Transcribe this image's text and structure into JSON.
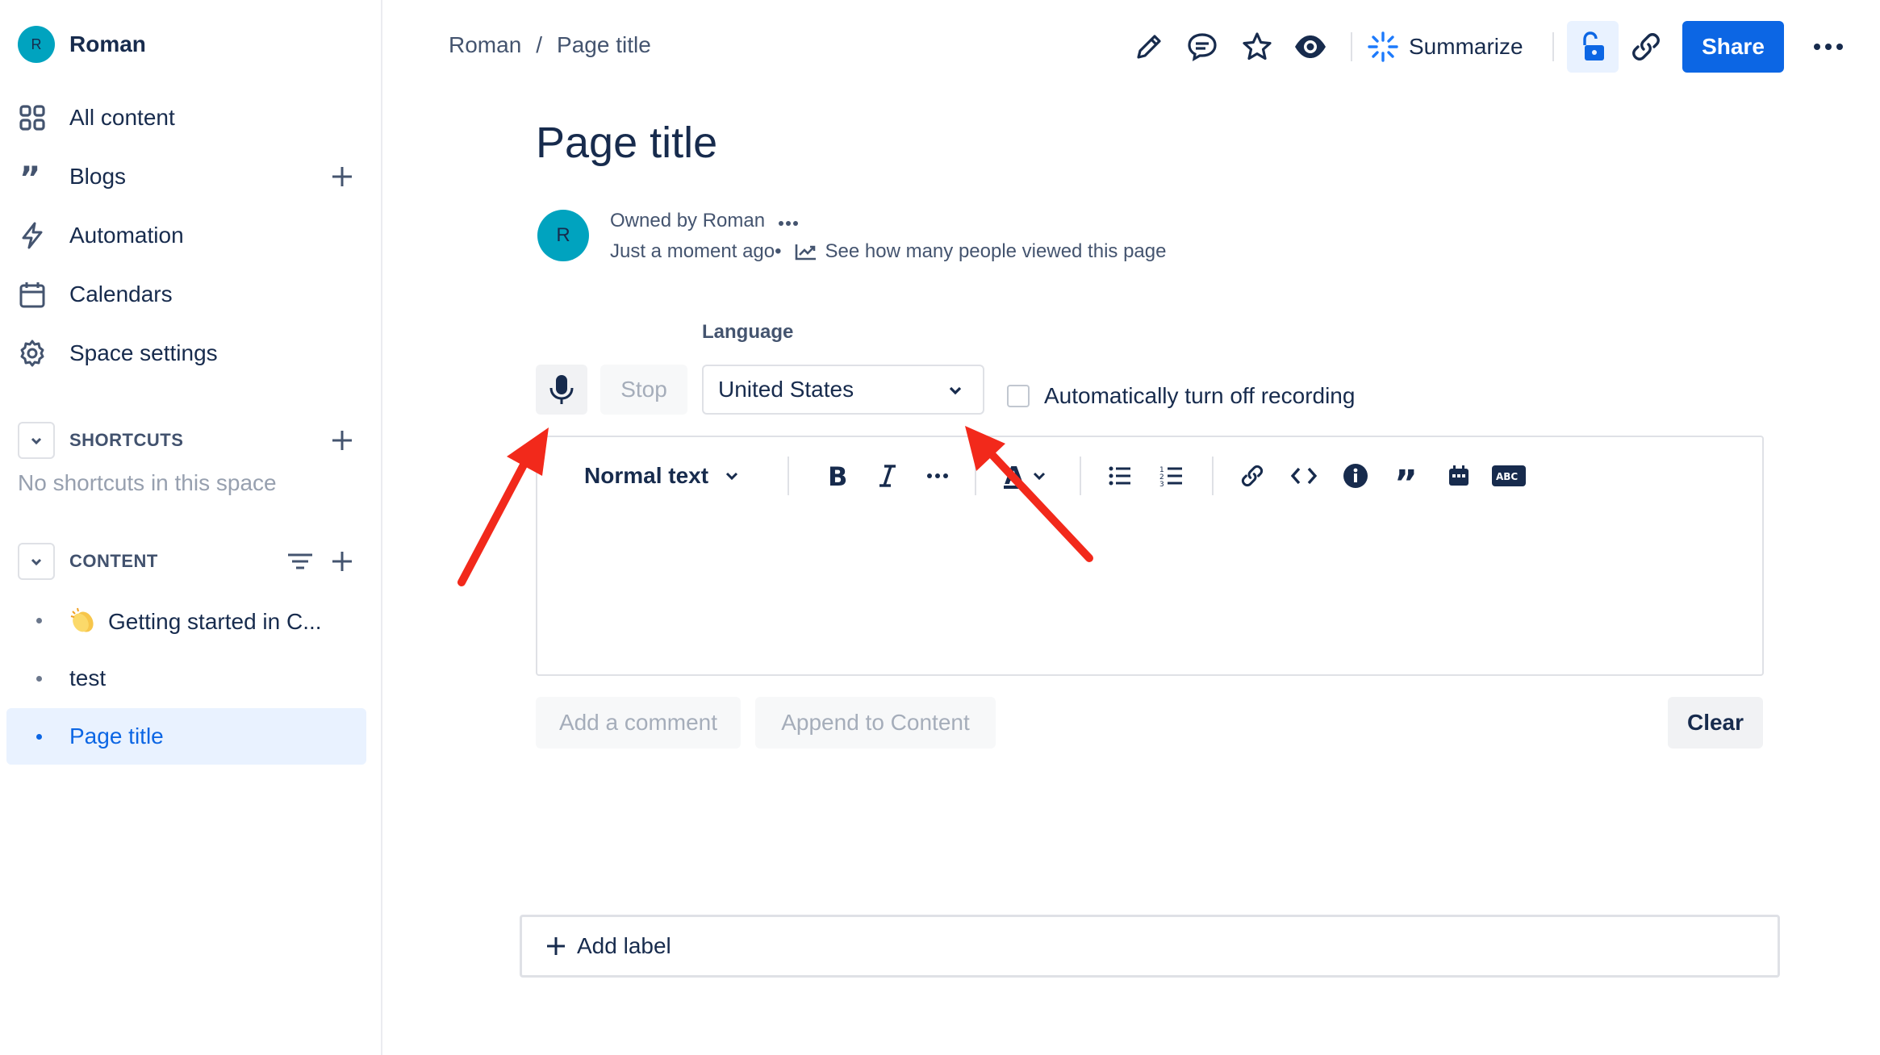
{
  "space": {
    "avatar_letter": "R",
    "name": "Roman"
  },
  "sidebar": {
    "items": [
      {
        "label": "All content",
        "icon": "grid-icon"
      },
      {
        "label": "Blogs",
        "icon": "quote-icon"
      },
      {
        "label": "Automation",
        "icon": "lightning-icon"
      },
      {
        "label": "Calendars",
        "icon": "calendar-icon"
      },
      {
        "label": "Space settings",
        "icon": "gear-icon"
      }
    ],
    "shortcuts": {
      "title": "SHORTCUTS",
      "empty": "No shortcuts in this space"
    },
    "content": {
      "title": "CONTENT",
      "tree": [
        {
          "label": "Getting started in C...",
          "emoji": "clapping-hands"
        },
        {
          "label": "test"
        },
        {
          "label": "Page title",
          "active": true
        }
      ]
    }
  },
  "header": {
    "breadcrumb": [
      "Roman",
      "/",
      "Page title"
    ],
    "summarize_label": "Summarize",
    "share_label": "Share"
  },
  "page": {
    "title": "Page title",
    "byline": {
      "avatar_letter": "R",
      "owned_by": "Owned by Roman",
      "time": "Just a moment ago",
      "separator": "•",
      "views_link": "See how many people viewed this page"
    }
  },
  "recorder": {
    "language_label": "Language",
    "stop_label": "Stop",
    "language_value": "United States",
    "auto_off_label": "Automatically turn off recording",
    "auto_off_checked": false
  },
  "editor": {
    "text_style": "Normal text",
    "add_comment_label": "Add a comment",
    "append_label": "Append to Content",
    "clear_label": "Clear"
  },
  "labels": {
    "add_label": "Add label"
  },
  "colors": {
    "primary": "#0c66e4",
    "avatar": "#00a3bf",
    "annotation_arrow": "#f2291b"
  }
}
